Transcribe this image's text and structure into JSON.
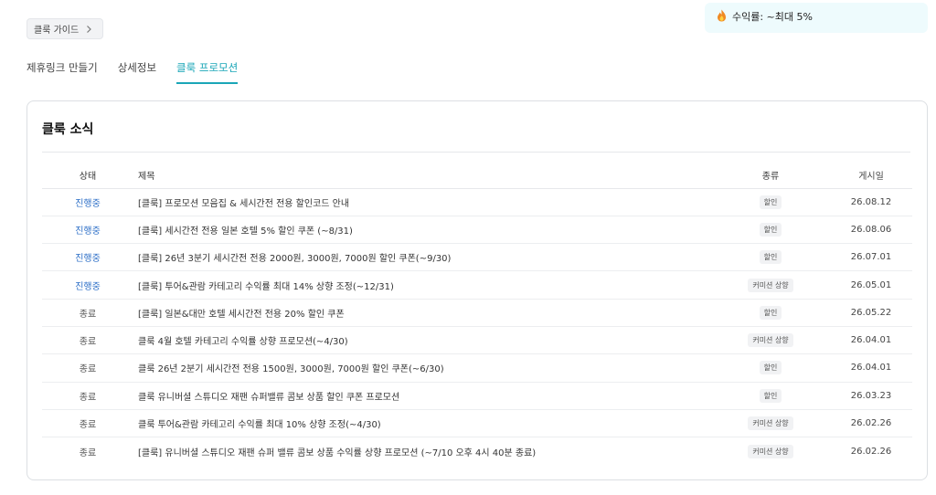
{
  "guide": {
    "label": "클룩 가이드"
  },
  "revenue": {
    "label": "수익률: ~최대 5%"
  },
  "tabs": [
    {
      "label": "제휴링크 만들기"
    },
    {
      "label": "상세정보"
    },
    {
      "label": "클룩 프로모션"
    }
  ],
  "panel": {
    "title": "클룩 소식"
  },
  "table": {
    "headers": {
      "status": "상태",
      "title": "제목",
      "type": "종류",
      "date": "게시일"
    },
    "rows": [
      {
        "status": "진행중",
        "title": "[클룩] 프로모션 모음집 & 세시간전 전용 할인코드 안내",
        "type": "할인",
        "date": "26.08.12"
      },
      {
        "status": "진행중",
        "title": "[클룩] 세시간전 전용 일본 호텔 5% 할인 쿠폰 (~8/31)",
        "type": "할인",
        "date": "26.08.06"
      },
      {
        "status": "진행중",
        "title": "[클룩] 26년 3분기 세시간전 전용 2000원, 3000원, 7000원 할인 쿠폰(~9/30)",
        "type": "할인",
        "date": "26.07.01"
      },
      {
        "status": "진행중",
        "title": "[클룩] 투어&관람 카테고리 수익률 최대 14% 상향 조정(~12/31)",
        "type": "커미션 상향",
        "date": "26.05.01"
      },
      {
        "status": "종료",
        "title": "[클룩] 일본&대만 호텔 세시간전 전용 20% 할인 쿠폰",
        "type": "할인",
        "date": "26.05.22"
      },
      {
        "status": "종료",
        "title": "클룩 4월 호텔 카테고리 수익률 상향 프로모션(~4/30)",
        "type": "커미션 상향",
        "date": "26.04.01"
      },
      {
        "status": "종료",
        "title": "클룩 26년 2분기 세시간전 전용 1500원, 3000원, 7000원 할인 쿠폰(~6/30)",
        "type": "할인",
        "date": "26.04.01"
      },
      {
        "status": "종료",
        "title": "클룩 유니버셜 스튜디오 재팬 슈퍼밸류 콤보 상품 할인 쿠폰 프로모션",
        "type": "할인",
        "date": "26.03.23"
      },
      {
        "status": "종료",
        "title": "클룩 투어&관람 카테고리 수익률 최대 10% 상향 조정(~4/30)",
        "type": "커미션 상향",
        "date": "26.02.26"
      },
      {
        "status": "종료",
        "title": "[클룩] 유니버셜 스튜디오 재팬 슈퍼 밸류 콤보 상품 수익률 상향 프로모션 (~7/10 오후 4시 40분 종료)",
        "type": "커미션 상향",
        "date": "26.02.26"
      }
    ]
  },
  "colors": {
    "accent": "#1aa6b7",
    "ongoing": "#2d6fc7",
    "revenue_bg": "#eefbfd"
  },
  "icons": {
    "guide": "chevron-right-icon",
    "revenue": "fire-icon"
  }
}
